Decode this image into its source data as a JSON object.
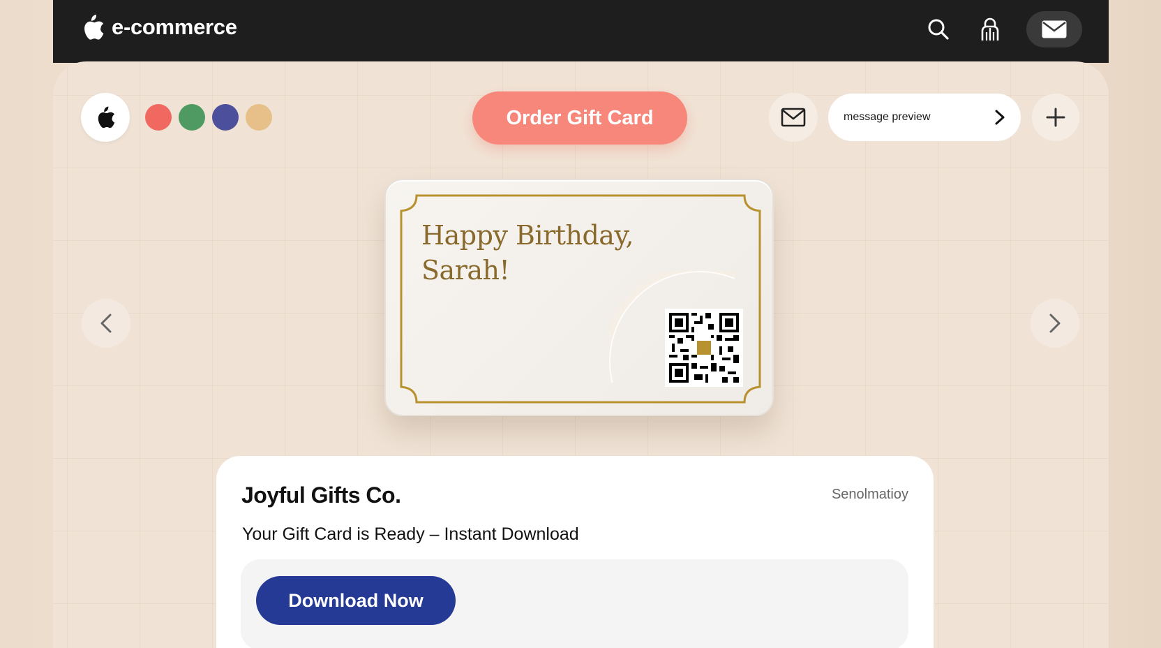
{
  "header": {
    "brand_name": "e-commerce",
    "icons": [
      "apple-logo-icon",
      "search-icon",
      "user-icon",
      "mail-icon"
    ]
  },
  "toolbar": {
    "swatches": [
      "#f0685f",
      "#4f9a63",
      "#4b4f9c",
      "#e7bf89"
    ],
    "order_label": "Order Gift Card",
    "message_preview_label": "message preview"
  },
  "gift_card": {
    "greeting_line1": "Happy Birthday,",
    "greeting_line2": "Sarah!",
    "accent_color": "#b8922e"
  },
  "panel": {
    "company": "Joyful Gifts Co.",
    "tag": "Senolmatioy",
    "subtitle": "Your Gift Card is Ready – Instant Download",
    "download_label": "Download Now"
  },
  "colors": {
    "topbar": "#1e1e1e",
    "order_button": "#f7877a",
    "download_button": "#243a94"
  }
}
